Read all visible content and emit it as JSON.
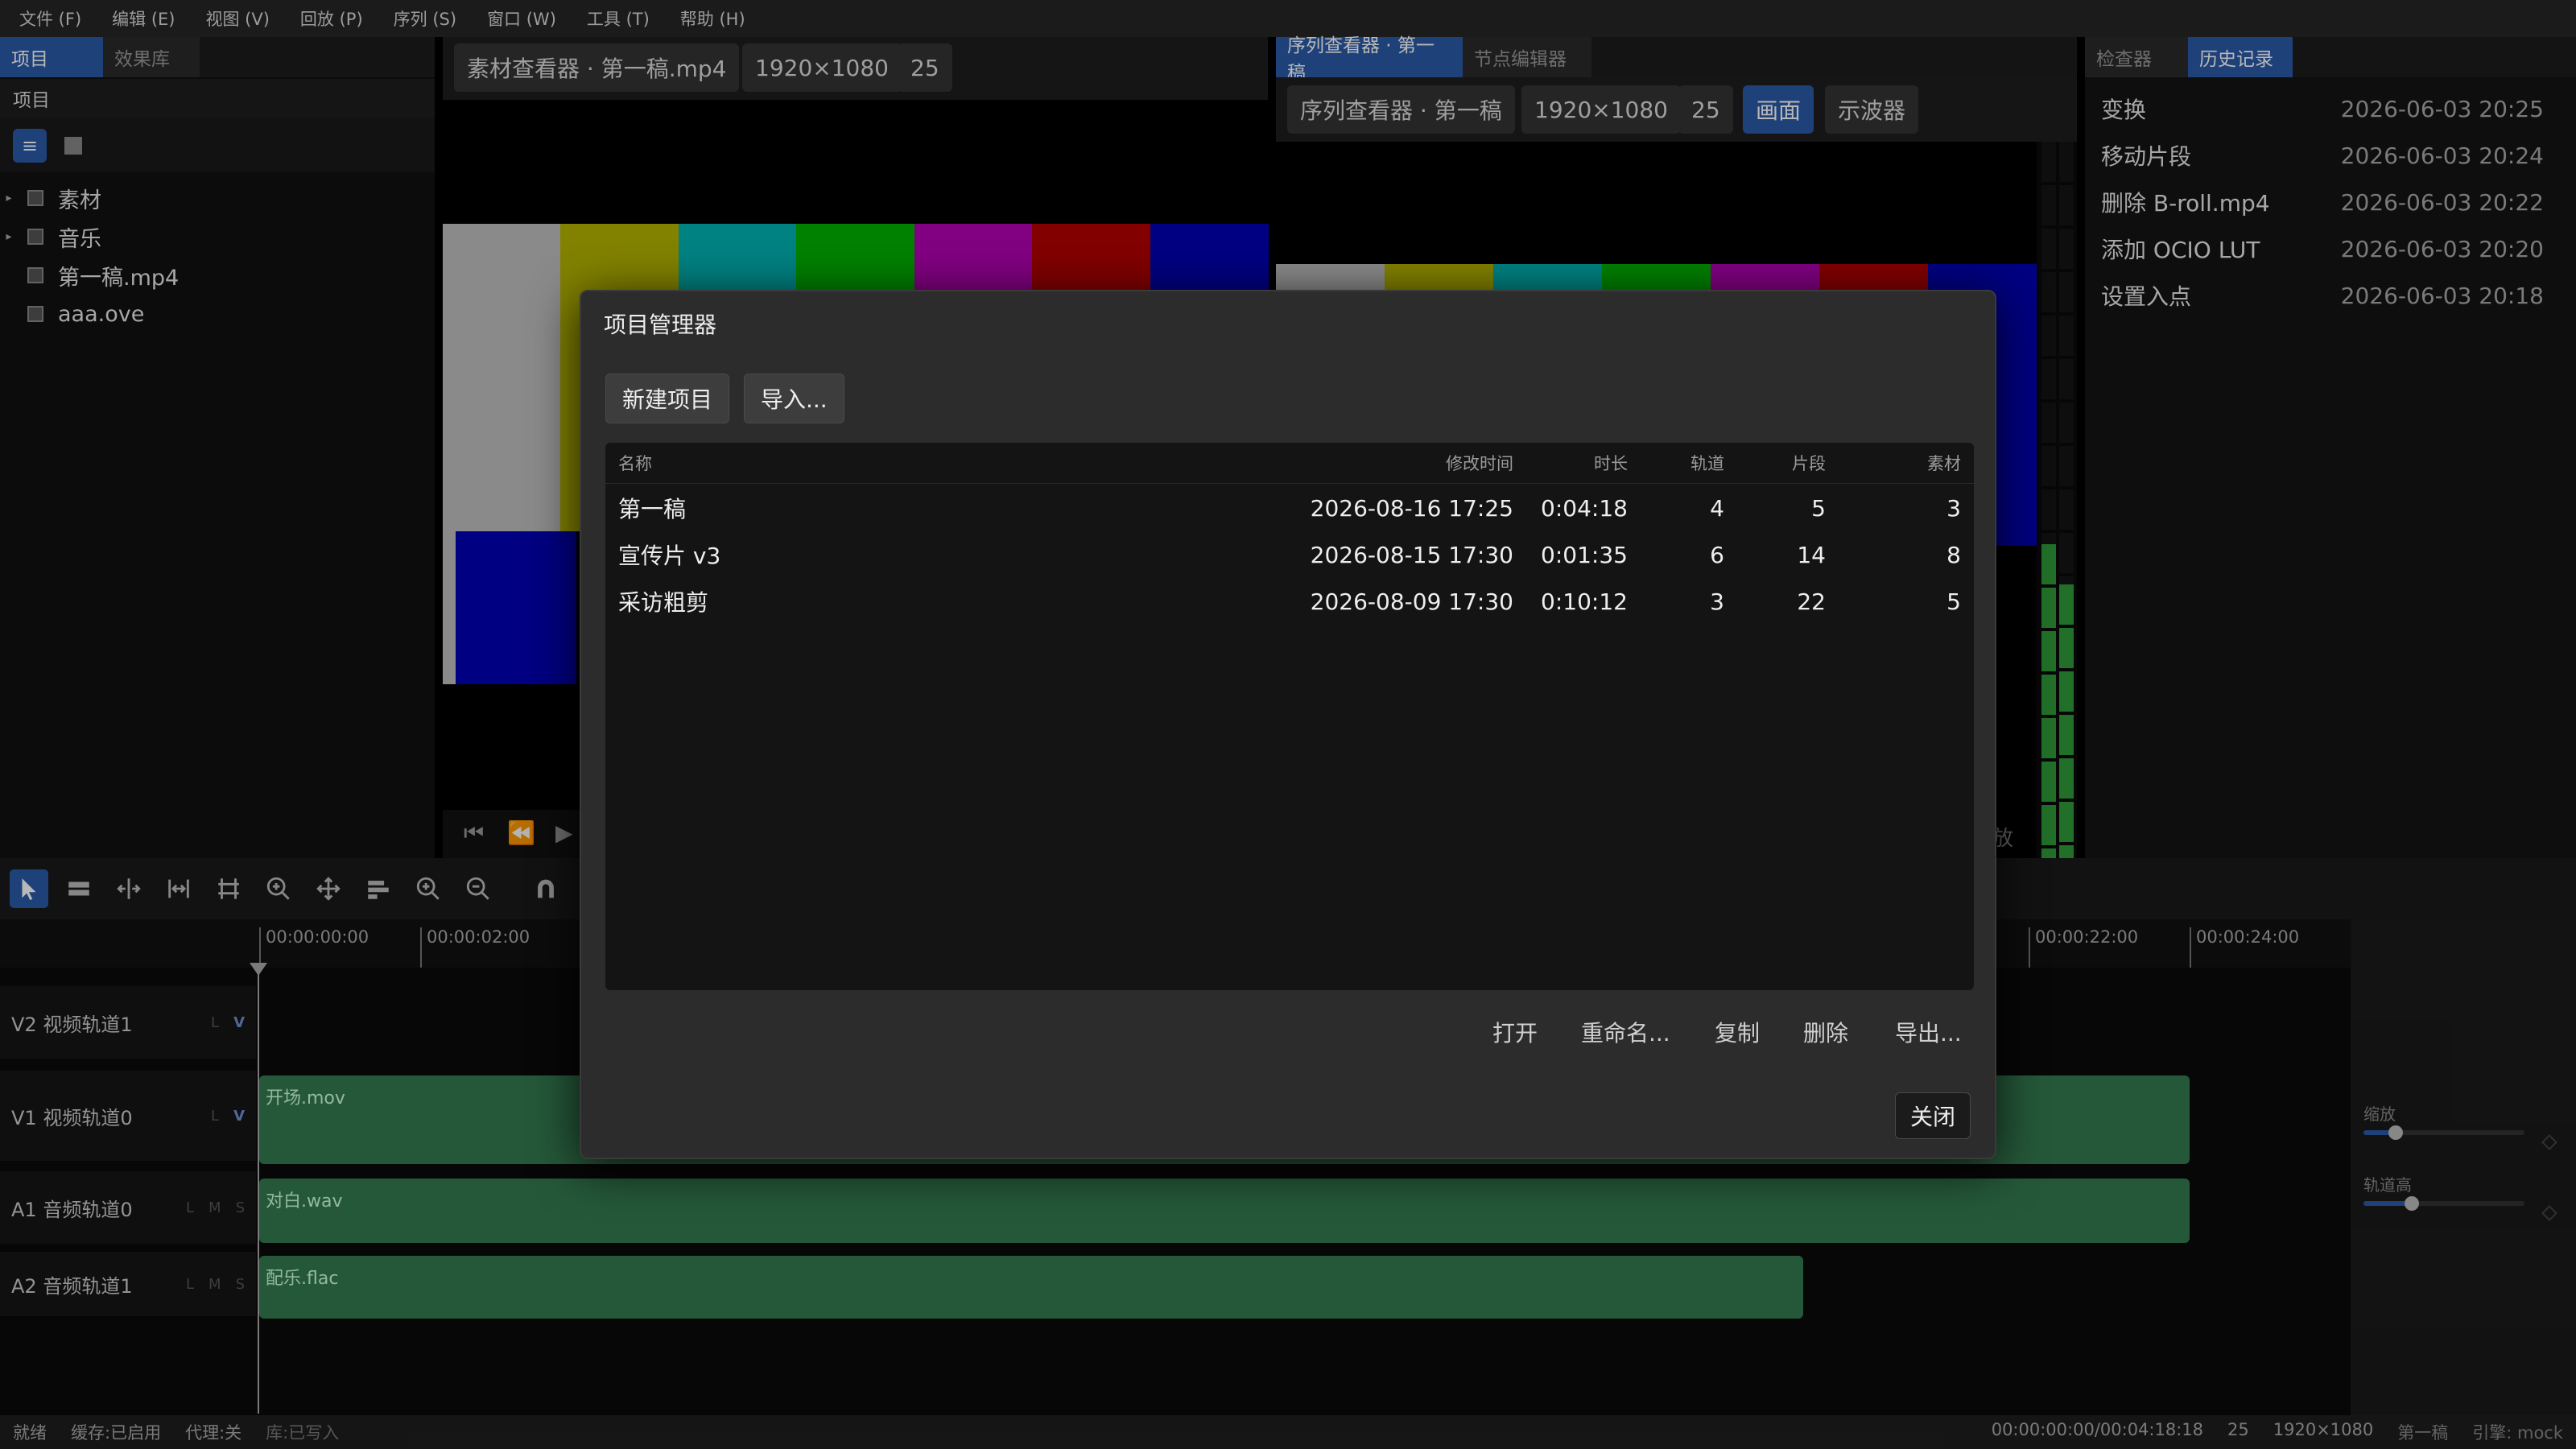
{
  "menubar": [
    "文件 (F)",
    "编辑 (E)",
    "视图 (V)",
    "回放 (P)",
    "序列 (S)",
    "窗口 (W)",
    "工具 (T)",
    "帮助 (H)"
  ],
  "project_panel": {
    "tabs": [
      "项目",
      "效果库"
    ],
    "title": "项目",
    "items": [
      {
        "name": "素材",
        "folder": true
      },
      {
        "name": "音乐",
        "folder": true
      },
      {
        "name": "第一稿.mp4",
        "folder": false
      },
      {
        "name": "aaa.ove",
        "folder": false
      }
    ]
  },
  "source_viewer": {
    "title": "素材查看器 · 第一稿.mp4",
    "resolution": "1920×1080",
    "fps": "25"
  },
  "sequence_viewer": {
    "tabs": [
      "序列查看器 · 第一稿",
      "节点编辑器"
    ],
    "title": "序列查看器 · 第一稿",
    "resolution": "1920×1080",
    "fps": "25",
    "mode_picture": "画面",
    "mode_scope": "示波器",
    "partial_label": "放"
  },
  "colors_bars": [
    "#c0c0c0",
    "#b4b400",
    "#00b4b4",
    "#00b400",
    "#b400b4",
    "#b40000",
    "#0000b4"
  ],
  "history_panel": {
    "tabs": [
      "检查器",
      "历史记录"
    ],
    "entries": [
      {
        "action": "变换",
        "time": "2026-06-03 20:25"
      },
      {
        "action": "移动片段",
        "time": "2026-06-03 20:24"
      },
      {
        "action": "删除 B-roll.mp4",
        "time": "2026-06-03 20:22"
      },
      {
        "action": "添加 OCIO LUT",
        "time": "2026-06-03 20:20"
      },
      {
        "action": "设置入点",
        "time": "2026-06-03 20:18"
      }
    ]
  },
  "timeline": {
    "ruler": [
      "00:00:00:00",
      "00:00:02:00",
      "00:00:22:00",
      "00:00:24:00"
    ],
    "tracks": [
      {
        "name": "V2 视频轨道1",
        "flags": [
          "L",
          "V"
        ]
      },
      {
        "name": "V1 视频轨道0",
        "flags": [
          "L",
          "V"
        ]
      },
      {
        "name": "A1 音频轨道0",
        "flags": [
          "L",
          "M",
          "S"
        ]
      },
      {
        "name": "A2 音频轨道1",
        "flags": [
          "L",
          "M",
          "S"
        ]
      }
    ],
    "clips": [
      {
        "label": "开场.mov"
      },
      {
        "label": "对白.wav"
      },
      {
        "label": "配乐.flac"
      }
    ],
    "side": {
      "zoom_label": "缩放",
      "zoom_level": 0.2,
      "track_height_label": "轨道高",
      "track_height_level": 0.3
    }
  },
  "status_bar": {
    "left": [
      "就绪",
      "缓存:已启用",
      "代理:关",
      "库:已写入"
    ],
    "right": [
      "00:00:00:00/00:04:18:18",
      "25",
      "1920×1080",
      "第一稿",
      "引擎: mock"
    ]
  },
  "dialog": {
    "title": "项目管理器",
    "new_button": "新建项目",
    "import_button": "导入...",
    "columns": [
      "名称",
      "修改时间",
      "时长",
      "轨道",
      "片段",
      "素材"
    ],
    "rows": [
      [
        "第一稿",
        "2026-08-16 17:25",
        "0:04:18",
        "4",
        "5",
        "3"
      ],
      [
        "宣传片 v3",
        "2026-08-15 17:30",
        "0:01:35",
        "6",
        "14",
        "8"
      ],
      [
        "采访粗剪",
        "2026-08-09 17:30",
        "0:10:12",
        "3",
        "22",
        "5"
      ]
    ],
    "actions": [
      "打开",
      "重命名...",
      "复制",
      "删除",
      "导出..."
    ],
    "close_button": "关闭"
  }
}
